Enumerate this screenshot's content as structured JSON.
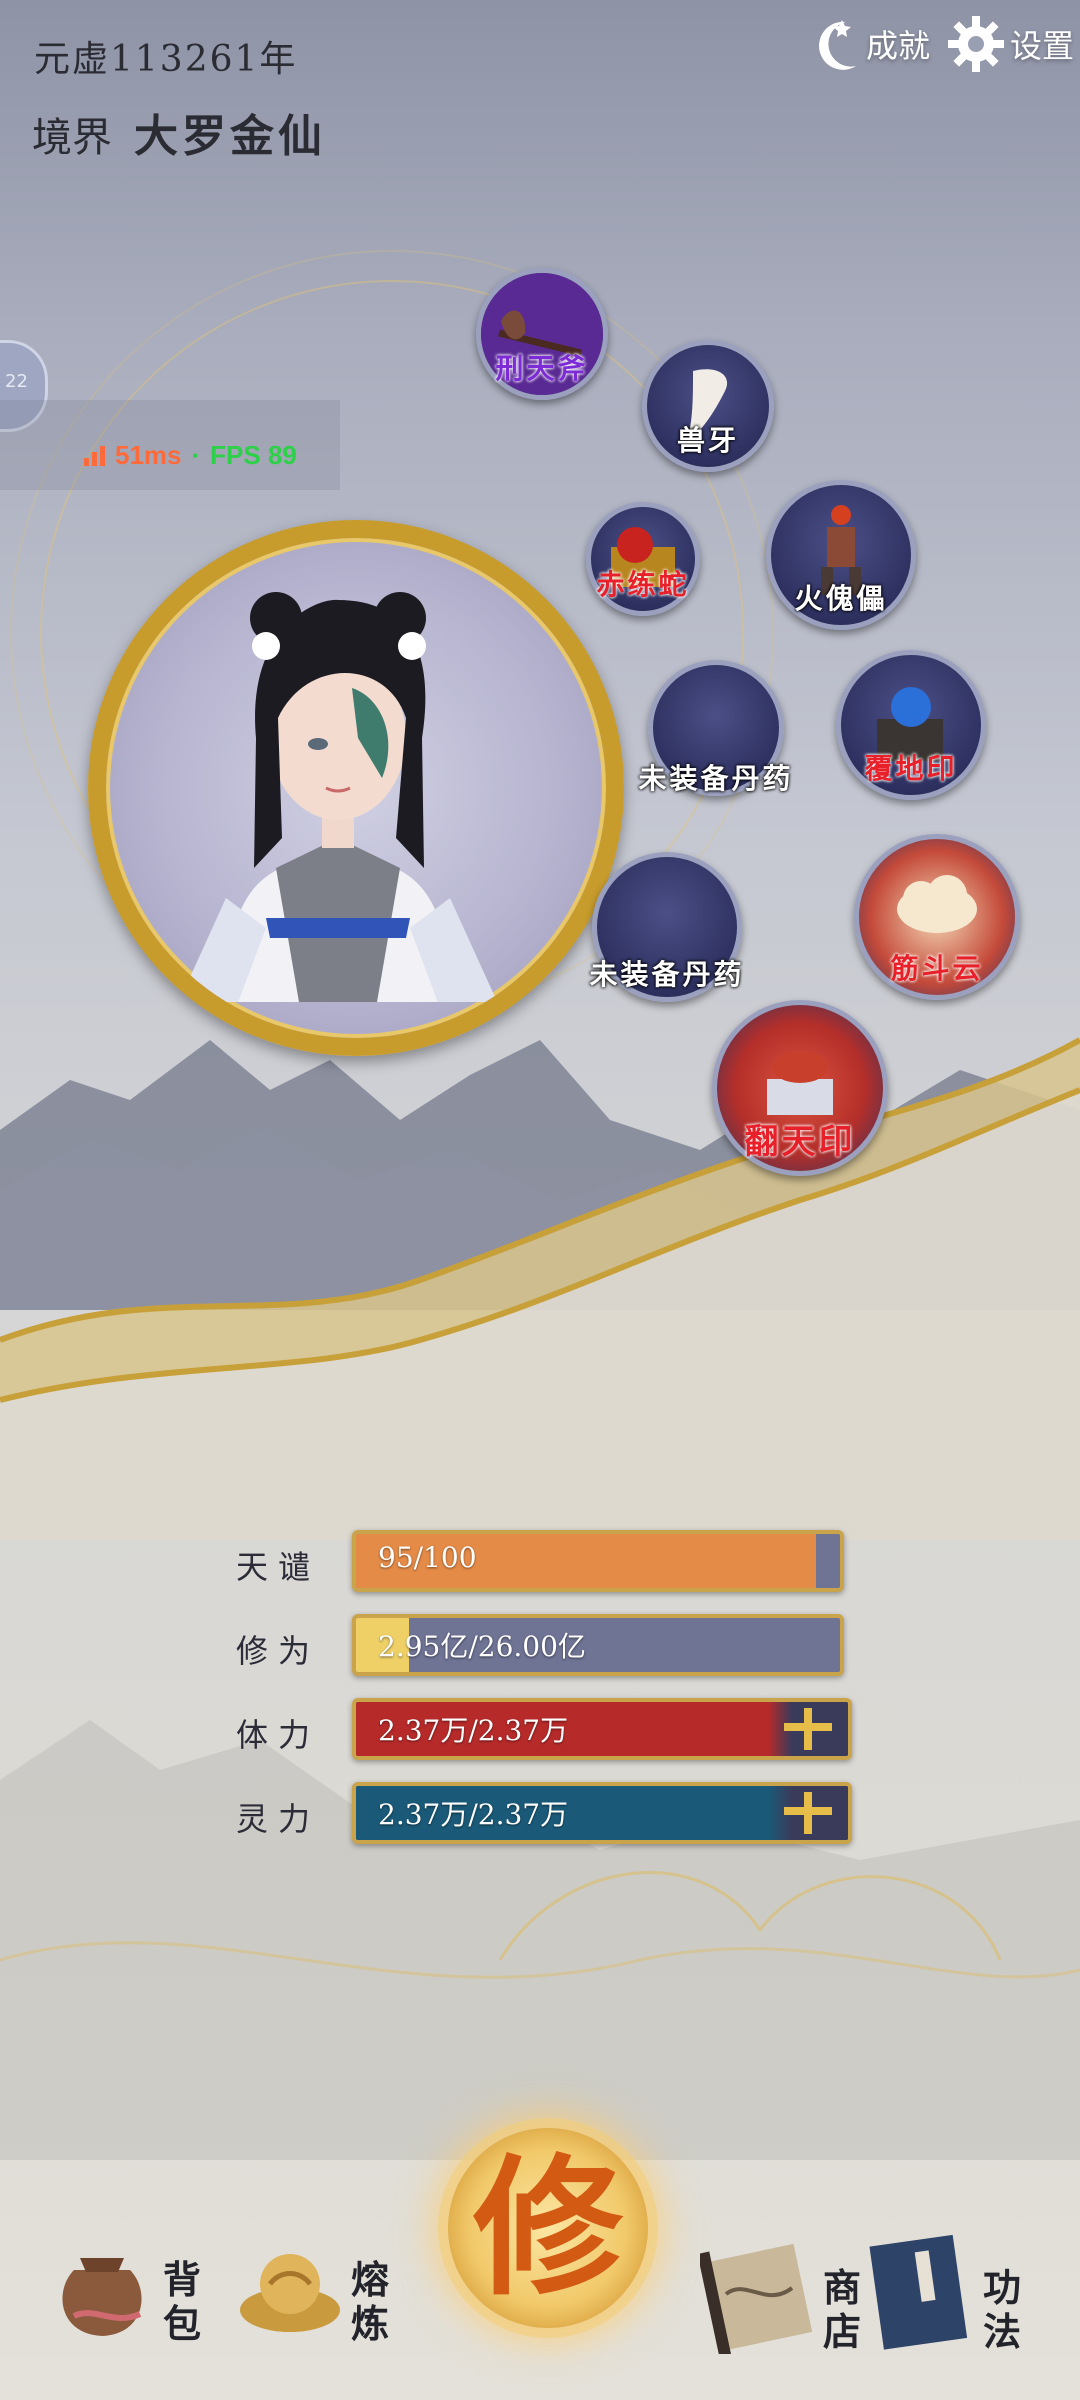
{
  "header": {
    "era": "元虚113261年",
    "realm_label": "境界",
    "realm_value": "大罗金仙"
  },
  "top_buttons": {
    "achievements": "成就",
    "settings": "设置"
  },
  "side_tab": {
    "text": "22"
  },
  "perf": {
    "latency": "51ms",
    "separator": "·",
    "fps": "FPS 89"
  },
  "equipment": {
    "slots": [
      {
        "label": "刑天斧",
        "style": "purple",
        "icon": "axe-icon",
        "filled": true
      },
      {
        "label": "兽牙",
        "style": "white",
        "icon": "fang-icon",
        "filled": true
      },
      {
        "label": "赤练蛇",
        "style": "red",
        "icon": "treasure-chest-icon",
        "filled": true
      },
      {
        "label": "火傀儡",
        "style": "white",
        "icon": "puppet-icon",
        "filled": true
      },
      {
        "label": "未装备丹药",
        "style": "white",
        "icon": "empty-slot-icon",
        "filled": false
      },
      {
        "label": "覆地印",
        "style": "red",
        "icon": "seal-orb-icon",
        "filled": true
      },
      {
        "label": "未装备丹药",
        "style": "white",
        "icon": "empty-slot-icon",
        "filled": false
      },
      {
        "label": "筋斗云",
        "style": "red",
        "icon": "cloud-icon",
        "filled": true
      },
      {
        "label": "翻天印",
        "style": "red",
        "icon": "seal-icon",
        "filled": true
      }
    ]
  },
  "stats": [
    {
      "label": "天谴",
      "value": "95/100",
      "fill_pct": 95,
      "color": "#e58b48",
      "plus": false
    },
    {
      "label": "修为",
      "value": "2.95亿/26.00亿",
      "fill_pct": 11,
      "color": "#eed067",
      "plus": false
    },
    {
      "label": "体力",
      "value": "2.37万/2.37万",
      "fill_pct": 100,
      "color": "#b72a2a",
      "plus": true
    },
    {
      "label": "灵力",
      "value": "2.37万/2.37万",
      "fill_pct": 100,
      "color": "#1a5a78",
      "plus": true
    }
  ],
  "nav": {
    "bag": "背包",
    "smelt": "熔炼",
    "cultivate": "修",
    "shop": "商店",
    "skills": "功法"
  },
  "colors": {
    "gold": "#c9a44a",
    "bar_track": "#6f7394",
    "slot_bg": "#2e3160"
  }
}
